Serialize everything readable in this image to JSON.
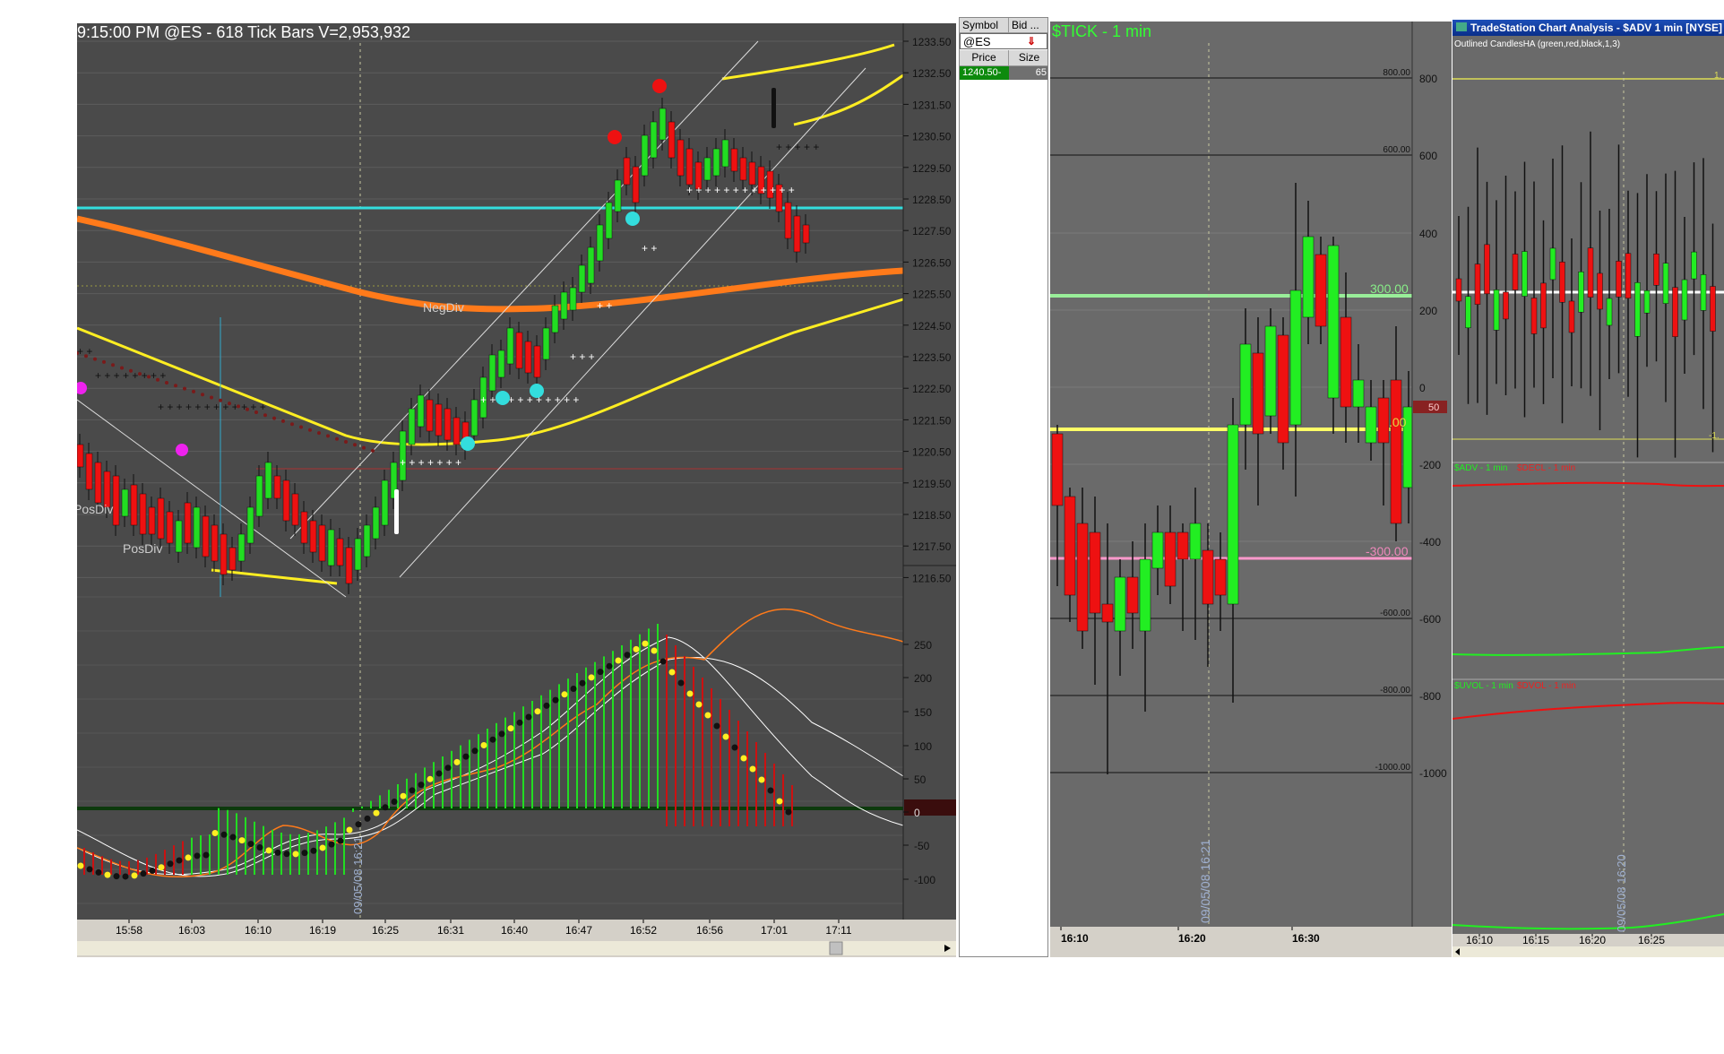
{
  "es_chart": {
    "title": "9:15:00 PM  @ES - 618 Tick Bars  V=2,953,932",
    "price_labels": [
      "1233.50",
      "1232.50",
      "1231.50",
      "1230.50",
      "1229.50",
      "1228.50",
      "1227.50",
      "1226.50",
      "1225.50",
      "1224.50",
      "1223.50",
      "1222.50",
      "1221.50",
      "1220.50",
      "1219.50",
      "1218.50",
      "1217.50",
      "1216.50"
    ],
    "osc_labels": [
      "250",
      "200",
      "150",
      "100",
      "50",
      "0",
      "-50",
      "-100"
    ],
    "time_labels": [
      "15:58",
      "16:03",
      "16:10",
      "16:19",
      "16:25",
      "16:31",
      "16:40",
      "16:47",
      "16:52",
      "16:56",
      "17:01",
      "17:11"
    ],
    "annotations": {
      "neg_div": "NegDiv",
      "pos_div": "PosDiv",
      "pos_div_left": "PosDiv"
    },
    "cursor_time": "09/05/08 16:21",
    "colors": {
      "up": "#22dd22",
      "down": "#ee1111",
      "cyan": "#33dddd",
      "orange": "#ff7a1a",
      "yellow": "#ffee22",
      "magenta": "#ee22ee"
    }
  },
  "dom": {
    "headers": [
      "Symbol",
      "Bid ..."
    ],
    "symbol": "@ES",
    "columns": [
      "Price",
      "Size"
    ],
    "price": "1240.50-",
    "size": "65"
  },
  "tick_chart": {
    "title": "$TICK - 1 min",
    "axis_labels": [
      "800",
      "600",
      "400",
      "200",
      "0",
      "-200",
      "-400",
      "-600",
      "-800",
      "-1000"
    ],
    "grid_labels": [
      "800.00",
      "600.00",
      "-600.00",
      "-800.00",
      "-1000.00"
    ],
    "level_labels": {
      "upper": "300.00",
      "zero": ".00",
      "lower": "-300.00"
    },
    "badge": "50",
    "cursor_time": "09/05/08 16:21",
    "time_labels": [
      "16:10",
      "16:20",
      "16:30"
    ]
  },
  "adv_chart": {
    "window_title": "TradeStation Chart Analysis - $ADV  1 min  [NYSE] ...",
    "study_label": "Outlined CandlesHA (green,red,black,1,3)",
    "right_labels": [
      "1.",
      "-1."
    ],
    "adv_label": "$ADV - 1 min",
    "decl_label": "$DECL - 1 min",
    "uvol_label": "$UVOL - 1 min",
    "dvol_label": "$DVOL - 1 min",
    "cursor_time": "09/05/08 16:20",
    "time_labels": [
      "16:10",
      "16:15",
      "16:20",
      "16:25"
    ]
  }
}
